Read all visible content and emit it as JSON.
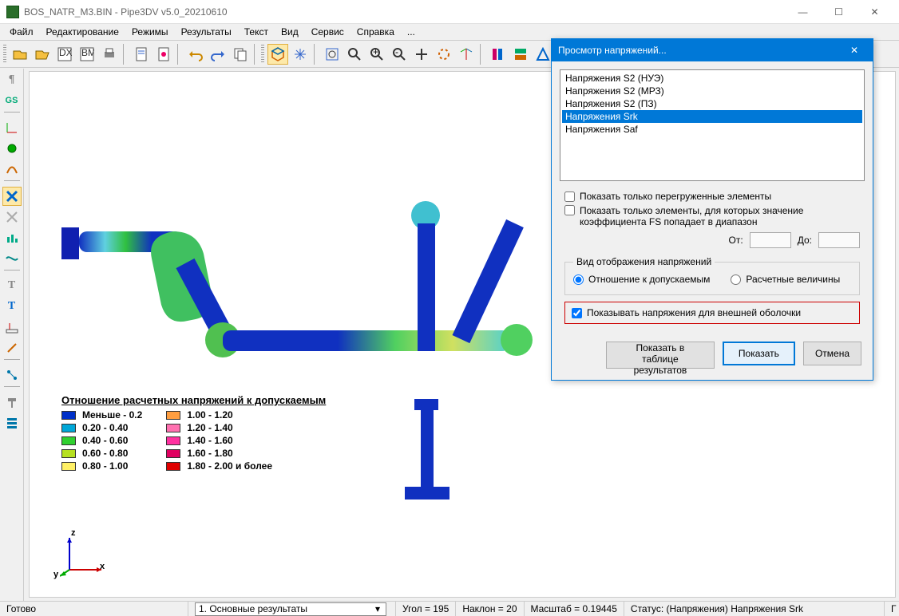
{
  "window": {
    "title": "BOS_NATR_M3.BIN - Pipe3DV v5.0_20210610"
  },
  "menus": [
    "Файл",
    "Редактирование",
    "Режимы",
    "Результаты",
    "Текст",
    "Вид",
    "Сервис",
    "Справка",
    "..."
  ],
  "legend": {
    "title": "Отношение расчетных напряжений к допускаемым",
    "left": [
      {
        "c": "#0030c8",
        "t": "Меньше - 0.2"
      },
      {
        "c": "#00a7d8",
        "t": "0.20 - 0.40"
      },
      {
        "c": "#30d030",
        "t": "0.40 - 0.60"
      },
      {
        "c": "#b6e020",
        "t": "0.60 - 0.80"
      },
      {
        "c": "#fff065",
        "t": "0.80 - 1.00"
      }
    ],
    "right": [
      {
        "c": "#ff9e40",
        "t": "1.00 - 1.20"
      },
      {
        "c": "#ff70b0",
        "t": "1.20 - 1.40"
      },
      {
        "c": "#ff30a0",
        "t": "1.40 - 1.60"
      },
      {
        "c": "#e00060",
        "t": "1.60 - 1.80"
      },
      {
        "c": "#e00000",
        "t": "1.80 - 2.00 и более"
      }
    ]
  },
  "axis": {
    "x": "x",
    "y": "y",
    "z": "z"
  },
  "dialog": {
    "title": "Просмотр напряжений...",
    "items": [
      "Напряжения S2 (НУЭ)",
      "Напряжения S2 (МРЗ)",
      "Напряжения S2 (ПЗ)",
      "Напряжения Srk",
      "Напряжения Saf"
    ],
    "selected_index": 3,
    "check_overloaded": "Показать только перегруженные элементы",
    "check_fs": "Показать только элементы, для которых значение коэффициента FS попадает в диапазон",
    "from": "От:",
    "to": "До:",
    "group": "Вид отображения напряжений",
    "radio1": "Отношение к допускаемым",
    "radio2": "Расчетные величины",
    "check_outer": "Показывать напряжения для внешней оболочки",
    "btn_table": "Показать в таблице результатов",
    "btn_show": "Показать",
    "btn_cancel": "Отмена"
  },
  "status": {
    "ready": "Готово",
    "combo": "1.  Основные результаты",
    "angle": "Угол = 195",
    "tilt": "Наклон = 20",
    "scale": "Масштаб = 0.19445",
    "state": "Статус: (Напряжения) Напряжения Srk",
    "tail": "Г"
  }
}
